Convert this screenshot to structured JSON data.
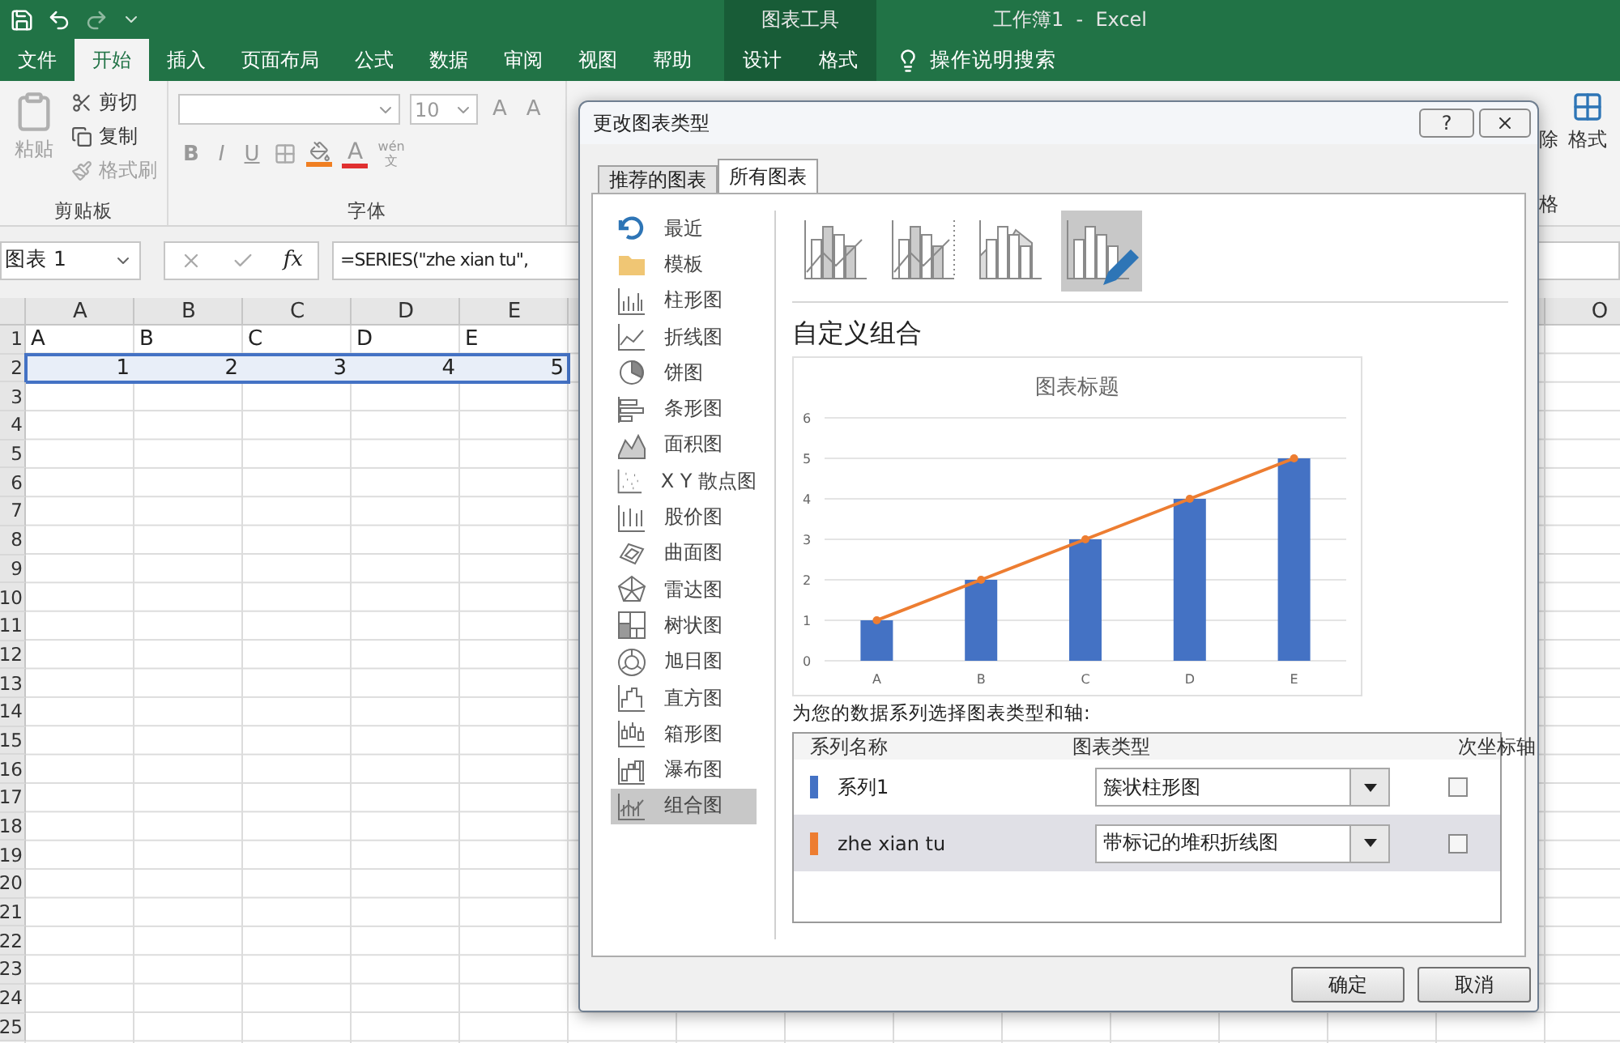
{
  "title_bar": {
    "context_label": "图表工具",
    "title": "工作簿1  -  Excel"
  },
  "ribbon_tabs": [
    {
      "label": "文件",
      "selected": false,
      "contextual": false
    },
    {
      "label": "开始",
      "selected": true,
      "contextual": false
    },
    {
      "label": "插入",
      "selected": false,
      "contextual": false
    },
    {
      "label": "页面布局",
      "selected": false,
      "contextual": false
    },
    {
      "label": "公式",
      "selected": false,
      "contextual": false
    },
    {
      "label": "数据",
      "selected": false,
      "contextual": false
    },
    {
      "label": "审阅",
      "selected": false,
      "contextual": false
    },
    {
      "label": "视图",
      "selected": false,
      "contextual": false
    },
    {
      "label": "帮助",
      "selected": false,
      "contextual": false
    },
    {
      "label": "设计",
      "selected": false,
      "contextual": true
    },
    {
      "label": "格式",
      "selected": false,
      "contextual": true
    }
  ],
  "tell_me": "操作说明搜索",
  "ribbon": {
    "clipboard": {
      "paste": "粘贴",
      "cut": "剪切",
      "copy": "复制",
      "format_painter": "格式刷",
      "label": "剪贴板"
    },
    "font": {
      "size": "10",
      "grow": "A",
      "shrink": "A",
      "styles": [
        "B",
        "I",
        "U"
      ],
      "font_color": "A",
      "phonetic_top": "wén",
      "phonetic_bottom": "文",
      "label": "字体"
    },
    "partial": {
      "clear": "除",
      "format": "格式",
      "group": "格"
    }
  },
  "formula_bar": {
    "name_box": "图表 1",
    "fx": "fx",
    "formula": "=SERIES(\"zhe xian tu\","
  },
  "sheet": {
    "columns": [
      "A",
      "B",
      "C",
      "D",
      "E",
      "O"
    ],
    "rows": [
      {
        "number": "1",
        "cells": [
          "A",
          "B",
          "C",
          "D",
          "E"
        ],
        "selected": false
      },
      {
        "number": "2",
        "cells": [
          "1",
          "2",
          "3",
          "4",
          "5"
        ],
        "selected": true
      },
      {
        "number": "3",
        "selected": false
      },
      {
        "number": "4",
        "selected": false
      },
      {
        "number": "5",
        "selected": false
      },
      {
        "number": "6",
        "selected": false
      },
      {
        "number": "7",
        "selected": false
      },
      {
        "number": "8",
        "selected": false
      },
      {
        "number": "9",
        "selected": false
      },
      {
        "number": "10",
        "selected": false
      },
      {
        "number": "11",
        "selected": false
      },
      {
        "number": "12",
        "selected": false
      },
      {
        "number": "13",
        "selected": false
      },
      {
        "number": "14",
        "selected": false
      },
      {
        "number": "15",
        "selected": false
      },
      {
        "number": "16",
        "selected": false
      },
      {
        "number": "17",
        "selected": false
      },
      {
        "number": "18",
        "selected": false
      },
      {
        "number": "19",
        "selected": false
      },
      {
        "number": "20",
        "selected": false
      },
      {
        "number": "21",
        "selected": false
      },
      {
        "number": "22",
        "selected": false
      },
      {
        "number": "23",
        "selected": false
      },
      {
        "number": "24",
        "selected": false
      },
      {
        "number": "25",
        "selected": false
      }
    ]
  },
  "dialog": {
    "title": "更改图表类型",
    "help": "?",
    "tabs": [
      {
        "label": "推荐的图表",
        "selected": false
      },
      {
        "label": "所有图表",
        "selected": true
      }
    ],
    "chart_types": [
      {
        "label": "最近",
        "selected": false
      },
      {
        "label": "模板",
        "selected": false
      },
      {
        "label": "柱形图",
        "selected": false
      },
      {
        "label": "折线图",
        "selected": false
      },
      {
        "label": "饼图",
        "selected": false
      },
      {
        "label": "条形图",
        "selected": false
      },
      {
        "label": "面积图",
        "selected": false
      },
      {
        "label": "X Y 散点图",
        "selected": false
      },
      {
        "label": "股价图",
        "selected": false
      },
      {
        "label": "曲面图",
        "selected": false
      },
      {
        "label": "雷达图",
        "selected": false
      },
      {
        "label": "树状图",
        "selected": false
      },
      {
        "label": "旭日图",
        "selected": false
      },
      {
        "label": "直方图",
        "selected": false
      },
      {
        "label": "箱形图",
        "selected": false
      },
      {
        "label": "瀑布图",
        "selected": false
      },
      {
        "label": "组合图",
        "selected": true
      }
    ],
    "subtypes": [
      {
        "selected": false
      },
      {
        "selected": false
      },
      {
        "selected": false
      },
      {
        "selected": true
      }
    ],
    "heading": "自定义组合",
    "preview": {
      "chart_data": {
        "type": "bar",
        "title": "图表标题",
        "categories": [
          "A",
          "B",
          "C",
          "D",
          "E"
        ],
        "series": [
          {
            "color": "#4472c4",
            "type": "bar",
            "values": [
              1,
              2,
              3,
              4,
              5
            ]
          },
          {
            "color": "#ed7d31",
            "type": "line",
            "marker": "circle",
            "values": [
              1,
              2,
              3,
              4,
              5
            ]
          }
        ],
        "grid": true,
        "ylim": [
          0,
          6
        ],
        "yticks": [
          0,
          1,
          2,
          3,
          4,
          5,
          6
        ]
      }
    },
    "series_prompt": "为您的数据系列选择图表类型和轴:",
    "series_table": {
      "columns": [
        "系列名称",
        "图表类型",
        "次坐标轴"
      ],
      "rows": [
        {
          "name": "系列1",
          "color": "#4472c4",
          "chart_type": "簇状柱形图",
          "secondary_axis": false,
          "selected": false
        },
        {
          "name": "zhe xian tu",
          "color": "#ed7d31",
          "chart_type": "带标记的堆积折线图",
          "secondary_axis": false,
          "selected": true
        }
      ]
    },
    "buttons": [
      "确定",
      "取消"
    ]
  }
}
